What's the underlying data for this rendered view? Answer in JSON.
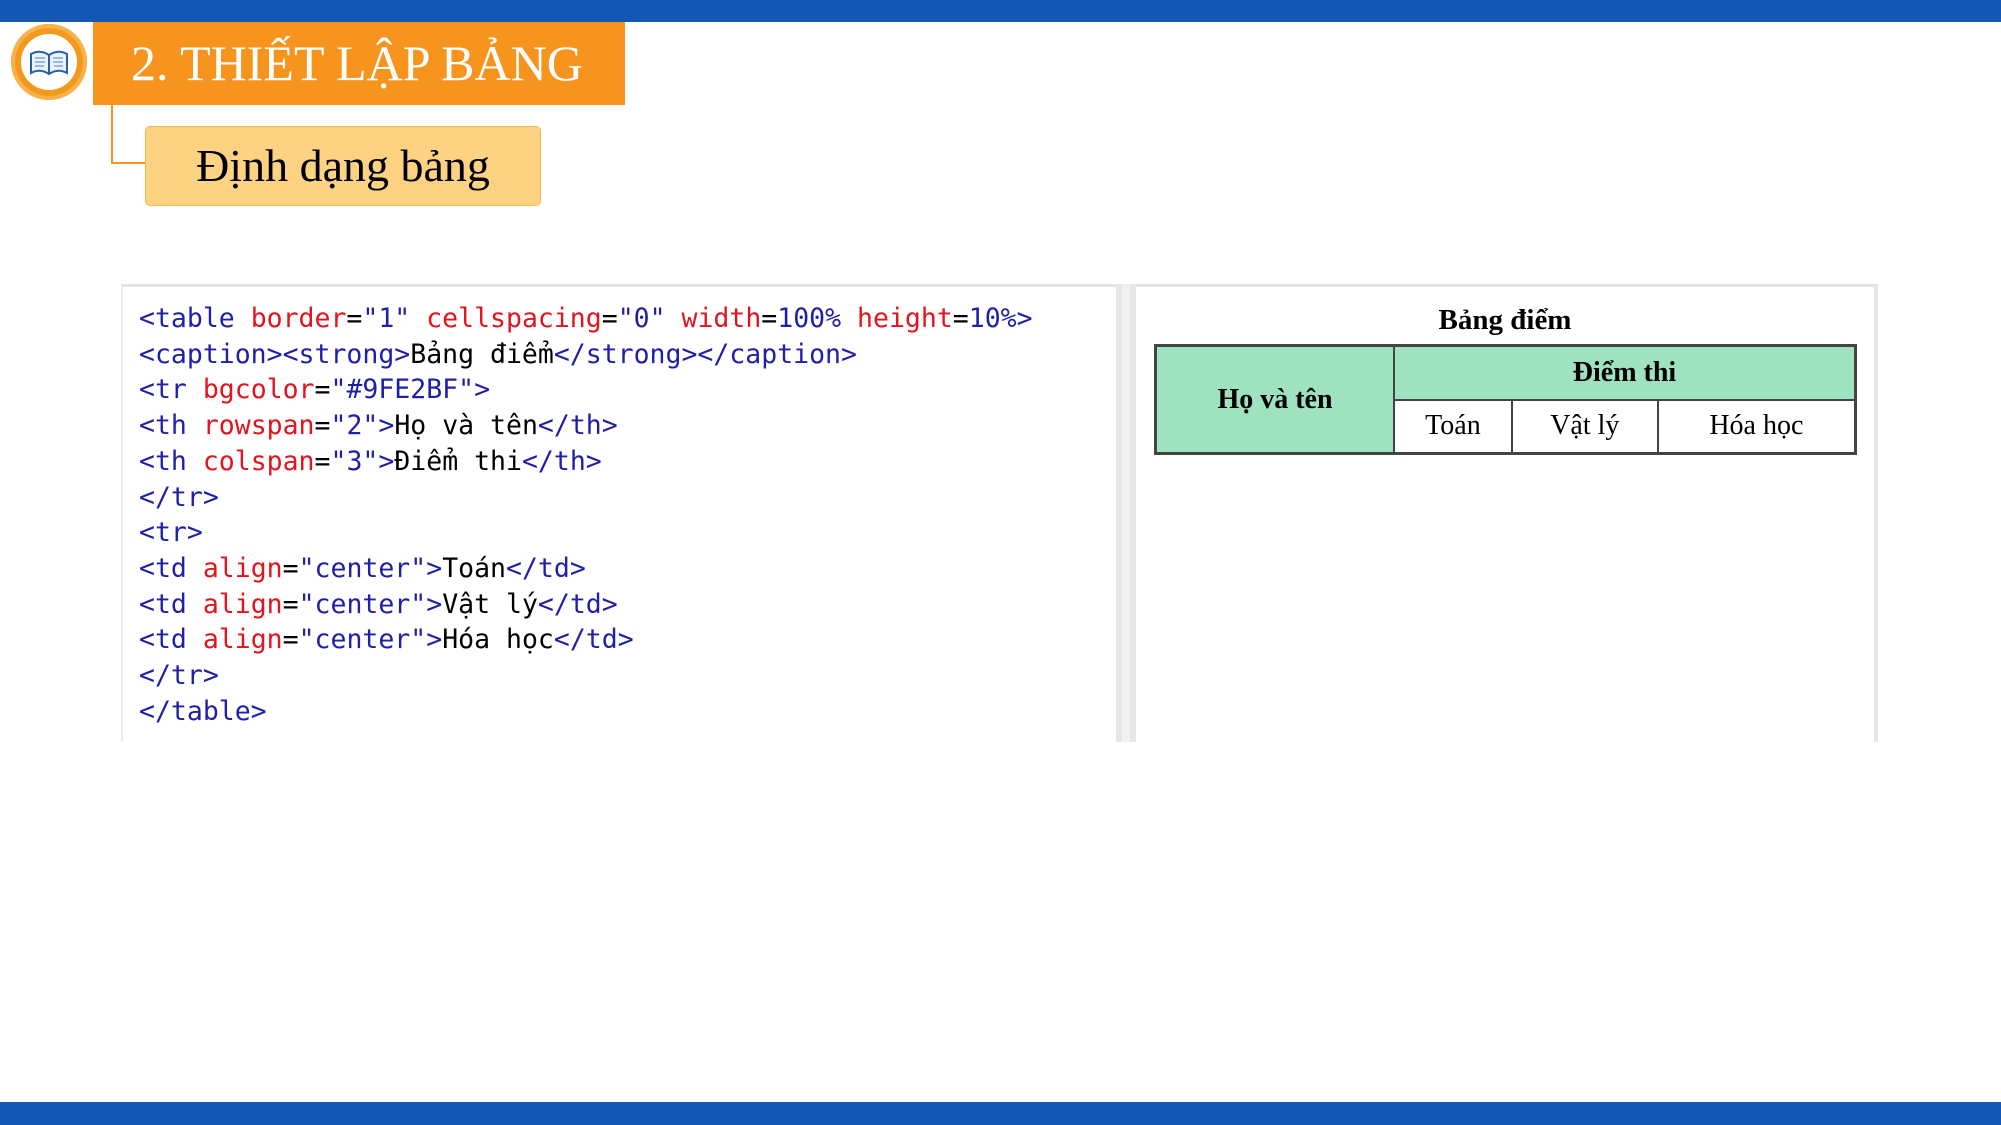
{
  "slide": {
    "title": "2. THIẾT LẬP BẢNG",
    "subtitle": "Định dạng bảng",
    "colors": {
      "accent": "#f7941d",
      "bar": "#1357b2",
      "subtitle_bg": "#fdd283",
      "header_bg": "#9FE2BF"
    },
    "logo_icon": "open-book-icon"
  },
  "code": [
    [
      {
        "c": "tg",
        "t": "<table "
      },
      {
        "c": "at",
        "t": "border"
      },
      {
        "c": "tx",
        "t": "="
      },
      {
        "c": "vl",
        "t": "\"1\" "
      },
      {
        "c": "at",
        "t": "cellspacing"
      },
      {
        "c": "tx",
        "t": "="
      },
      {
        "c": "vl",
        "t": "\"0\" "
      },
      {
        "c": "at",
        "t": "width"
      },
      {
        "c": "tx",
        "t": "="
      },
      {
        "c": "vl",
        "t": "100% "
      },
      {
        "c": "at",
        "t": "height"
      },
      {
        "c": "tx",
        "t": "="
      },
      {
        "c": "vl",
        "t": "10%>"
      }
    ],
    [
      {
        "c": "tg",
        "t": "<caption><strong>"
      },
      {
        "c": "tx",
        "t": "Bảng điểm"
      },
      {
        "c": "tg",
        "t": "</strong></caption>"
      }
    ],
    [
      {
        "c": "tg",
        "t": "<tr "
      },
      {
        "c": "at",
        "t": "bgcolor"
      },
      {
        "c": "tx",
        "t": "="
      },
      {
        "c": "vl",
        "t": "\"#9FE2BF\""
      },
      {
        "c": "tg",
        "t": ">"
      }
    ],
    [
      {
        "c": "tg",
        "t": "<th "
      },
      {
        "c": "at",
        "t": "rowspan"
      },
      {
        "c": "tx",
        "t": "="
      },
      {
        "c": "vl",
        "t": "\"2\""
      },
      {
        "c": "tg",
        "t": ">"
      },
      {
        "c": "tx",
        "t": "Họ và tên"
      },
      {
        "c": "tg",
        "t": "</th>"
      }
    ],
    [
      {
        "c": "tg",
        "t": "<th "
      },
      {
        "c": "at",
        "t": "colspan"
      },
      {
        "c": "tx",
        "t": "="
      },
      {
        "c": "vl",
        "t": "\"3\""
      },
      {
        "c": "tg",
        "t": ">"
      },
      {
        "c": "tx",
        "t": "Điểm thi"
      },
      {
        "c": "tg",
        "t": "</th>"
      }
    ],
    [
      {
        "c": "tg",
        "t": "</tr>"
      }
    ],
    [
      {
        "c": "tg",
        "t": "<tr>"
      }
    ],
    [
      {
        "c": "tg",
        "t": "<td "
      },
      {
        "c": "at",
        "t": "align"
      },
      {
        "c": "tx",
        "t": "="
      },
      {
        "c": "vl",
        "t": "\"center\""
      },
      {
        "c": "tg",
        "t": ">"
      },
      {
        "c": "tx",
        "t": "Toán"
      },
      {
        "c": "tg",
        "t": "</td>"
      }
    ],
    [
      {
        "c": "tg",
        "t": "<td "
      },
      {
        "c": "at",
        "t": "align"
      },
      {
        "c": "tx",
        "t": "="
      },
      {
        "c": "vl",
        "t": "\"center\""
      },
      {
        "c": "tg",
        "t": ">"
      },
      {
        "c": "tx",
        "t": "Vật lý"
      },
      {
        "c": "tg",
        "t": "</td>"
      }
    ],
    [
      {
        "c": "tg",
        "t": "<td "
      },
      {
        "c": "at",
        "t": "align"
      },
      {
        "c": "tx",
        "t": "="
      },
      {
        "c": "vl",
        "t": "\"center\""
      },
      {
        "c": "tg",
        "t": ">"
      },
      {
        "c": "tx",
        "t": "Hóa học"
      },
      {
        "c": "tg",
        "t": "</td>"
      }
    ],
    [
      {
        "c": "tg",
        "t": "</tr>"
      }
    ],
    [
      {
        "c": "tg",
        "t": "</table>"
      }
    ]
  ],
  "preview": {
    "caption": "Bảng điểm",
    "name_header": "Họ và tên",
    "score_header": "Điểm thi",
    "subjects": [
      "Toán",
      "Vật lý",
      "Hóa học"
    ]
  }
}
